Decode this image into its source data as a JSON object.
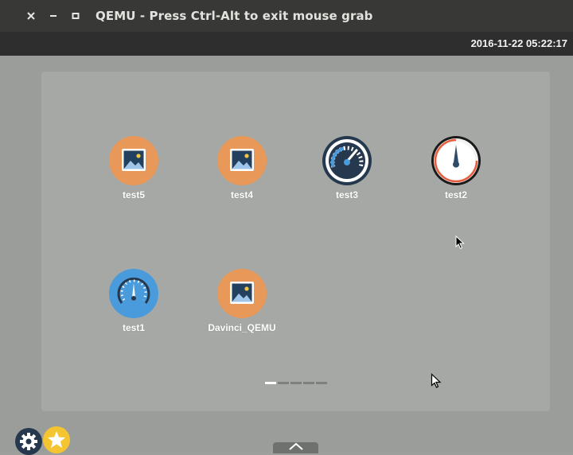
{
  "window": {
    "title": "QEMU - Press Ctrl-Alt to exit mouse grab",
    "close_icon": "close-icon",
    "minimize_icon": "minimize-icon",
    "maximize_icon": "maximize-icon"
  },
  "statusbar": {
    "clock": "2016-11-22 05:22:17"
  },
  "apps": [
    {
      "label": "test5",
      "icon": "image-app-icon"
    },
    {
      "label": "test4",
      "icon": "image-app-icon"
    },
    {
      "label": "test3",
      "icon": "speedometer-dark-icon"
    },
    {
      "label": "test2",
      "icon": "gauge-dial-icon"
    },
    {
      "label": "test1",
      "icon": "speedometer-blue-icon"
    },
    {
      "label": "Davinci_QEMU",
      "icon": "image-app-icon"
    }
  ],
  "pager": {
    "pages": 5,
    "active_page": 1
  },
  "colors": {
    "image_icon_bg": "#e8995a",
    "blue_icon_bg": "#4a9bdc",
    "dark_icon_bg": "#26384d",
    "star_badge": "#f5c531"
  }
}
